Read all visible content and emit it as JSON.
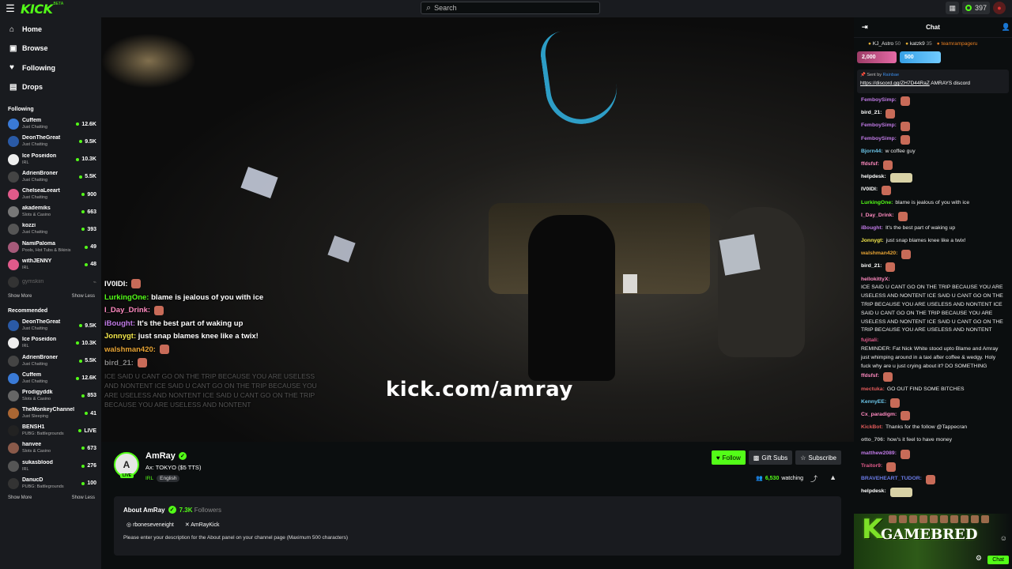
{
  "header": {
    "logo": "KICK",
    "logo_tag": "BETA",
    "search_placeholder": "Search",
    "coins": "397"
  },
  "sidebar": {
    "nav": [
      {
        "label": "Home",
        "icon": "home-icon",
        "glyph": "⌂"
      },
      {
        "label": "Browse",
        "icon": "browse-icon",
        "glyph": "▣"
      },
      {
        "label": "Following",
        "icon": "heart-icon",
        "glyph": "♥"
      },
      {
        "label": "Drops",
        "icon": "drops-icon",
        "glyph": "▤"
      }
    ],
    "following_title": "Following",
    "following": [
      {
        "name": "Cuffem",
        "category": "Just Chatting",
        "viewers": "12.6K",
        "color": "#3a7ad6"
      },
      {
        "name": "DeonTheGreat",
        "category": "Just Chatting",
        "viewers": "9.5K",
        "color": "#2a5aa6"
      },
      {
        "name": "Ice Poseidon",
        "category": "IRL",
        "viewers": "10.3K",
        "color": "#eeeeee"
      },
      {
        "name": "AdrienBroner",
        "category": "Just Chatting",
        "viewers": "5.5K",
        "color": "#444444"
      },
      {
        "name": "ChelseaLeeart",
        "category": "Just Chatting",
        "viewers": "900",
        "color": "#e05a8a"
      },
      {
        "name": "akademiks",
        "category": "Slots & Casino",
        "viewers": "663",
        "color": "#777777"
      },
      {
        "name": "kozzi",
        "category": "Just Chatting",
        "viewers": "393",
        "color": "#555555"
      },
      {
        "name": "NamiPaloma",
        "category": "Pools, Hot Tubs & Bikinis",
        "viewers": "49",
        "color": "#a65a7a"
      },
      {
        "name": "withJENNY",
        "category": "IRL",
        "viewers": "48",
        "color": "#e05a8a"
      }
    ],
    "offline_channel": "gymskiin",
    "show_more": "Show More",
    "show_less": "Show Less",
    "recommended_title": "Recommended",
    "recommended": [
      {
        "name": "DeonTheGreat",
        "category": "Just Chatting",
        "viewers": "9.5K",
        "color": "#2a5aa6"
      },
      {
        "name": "Ice Poseidon",
        "category": "IRL",
        "viewers": "10.3K",
        "color": "#eeeeee"
      },
      {
        "name": "AdrienBroner",
        "category": "Just Chatting",
        "viewers": "5.5K",
        "color": "#444444"
      },
      {
        "name": "Cuffem",
        "category": "Just Chatting",
        "viewers": "12.6K",
        "color": "#3a7ad6"
      },
      {
        "name": "Prodigyddk",
        "category": "Slots & Casino",
        "viewers": "853",
        "color": "#666666"
      },
      {
        "name": "TheMonkeyChannel",
        "category": "Just Sleeping",
        "viewers": "41",
        "color": "#aa6633"
      },
      {
        "name": "BENSH1",
        "category": "PUBG: Battlegrounds",
        "viewers": "LIVE",
        "color": "#222222"
      },
      {
        "name": "hanvee",
        "category": "Slots & Casino",
        "viewers": "673",
        "color": "#8a5a4a"
      },
      {
        "name": "sukasblood",
        "category": "IRL",
        "viewers": "276",
        "color": "#555555"
      },
      {
        "name": "DanucD",
        "category": "PUBG: Battlegrounds",
        "viewers": "100",
        "color": "#333333"
      }
    ]
  },
  "video": {
    "overlay_chat": [
      {
        "user": "IV0IDI:",
        "text": "",
        "color": "#ffffff"
      },
      {
        "user": "LurkingOne:",
        "text": "blame is jealous of you with ice",
        "color": "#53fc18"
      },
      {
        "user": "I_Day_Drink:",
        "text": "",
        "color": "#ff8ac0"
      },
      {
        "user": "iBought:",
        "text": "It's the best part of waking up",
        "color": "#c07ae6"
      },
      {
        "user": "Jonnygt:",
        "text": "just snap blames knee like a twix!",
        "color": "#f2e64b"
      },
      {
        "user": "walshman420:",
        "text": "",
        "color": "#e6a334"
      },
      {
        "user": "bird_21:",
        "text": "",
        "color": "#888888"
      }
    ],
    "overlay_faded": "ICE SAID U CANT GO ON THE TRIP BECAUSE YOU ARE USELESS AND NONTENT ICE SAID U CANT GO ON THE TRIP BECAUSE YOU ARE USELESS AND NONTENT ICE SAID U CANT GO ON THE TRIP BECAUSE YOU ARE USELESS AND NONTENT",
    "watermark": "kick.com/amray"
  },
  "stream": {
    "streamer": "AmRay",
    "live": "LIVE",
    "title": "Ax: TOKYO ($5 TTS)",
    "category": "IRL",
    "language": "English",
    "follow": "Follow",
    "gift_subs": "Gift Subs",
    "subscribe": "Subscribe",
    "viewers": "6,530",
    "watching": "watching"
  },
  "about": {
    "title": "About AmRay",
    "followers_count": "7.3K",
    "followers_label": "Followers",
    "instagram": "rboneseveneight",
    "x": "AmRayKick",
    "description": "Please enter your description for the About panel on your channel page (Maximum 500 characters)"
  },
  "chat": {
    "title": "Chat",
    "top_gifters": [
      {
        "name": "KJ_Astro",
        "count": "50"
      },
      {
        "name": "katzk9",
        "count": "35"
      },
      {
        "name": "teamrampageru",
        "count": ""
      }
    ],
    "pill_pink": "2,000",
    "pill_blue": "500",
    "pinned_by_label": "Sent by",
    "pinned_by_user": "Rainbae",
    "pinned_link": "https://discord.gg/ZH7D44RaZ",
    "pinned_text": "AMRAYS discord",
    "messages": [
      {
        "user": "FemboySimp:",
        "text": "",
        "color": "#c07ae6",
        "emote": "normal"
      },
      {
        "user": "bird_21:",
        "text": "",
        "color": "#ffffff",
        "emote": "normal"
      },
      {
        "user": "FemboySimp:",
        "text": "",
        "color": "#c07ae6",
        "emote": "normal"
      },
      {
        "user": "FemboySimp:",
        "text": "",
        "color": "#c07ae6",
        "emote": "normal"
      },
      {
        "user": "Bjorn44:",
        "text": "w coffee guy",
        "color": "#6ac3e6",
        "emote": ""
      },
      {
        "user": "ffdsfsf:",
        "text": "",
        "color": "#ff8ac0",
        "emote": "normal"
      },
      {
        "user": "helpdesk:",
        "text": "",
        "color": "#ffffff",
        "emote": "big"
      },
      {
        "user": "IV0IDI:",
        "text": "",
        "color": "#ffffff",
        "emote": "normal"
      },
      {
        "user": "LurkingOne:",
        "text": "blame is jealous of you with ice",
        "color": "#53fc18",
        "emote": ""
      },
      {
        "user": "I_Day_Drink:",
        "text": "",
        "color": "#ff8ac0",
        "emote": "normal"
      },
      {
        "user": "iBought:",
        "text": "It's the best part of waking up",
        "color": "#c07ae6",
        "emote": ""
      },
      {
        "user": "Jonnygt:",
        "text": "just snap blames knee like a twix!",
        "color": "#f2e64b",
        "emote": ""
      },
      {
        "user": "walshman420:",
        "text": "",
        "color": "#e6a334",
        "emote": "normal"
      },
      {
        "user": "bird_21:",
        "text": "",
        "color": "#ffffff",
        "emote": "normal"
      },
      {
        "user": "hellokittyX:",
        "text": "ICE SAID U CANT GO ON THE TRIP BECAUSE YOU ARE USELESS AND NONTENT ICE SAID U CANT GO ON THE TRIP BECAUSE YOU ARE USELESS AND NONTENT ICE SAID U CANT GO ON THE TRIP BECAUSE YOU ARE USELESS AND NONTENT ICE SAID U CANT GO ON THE TRIP BECAUSE YOU ARE USELESS AND NONTENT",
        "color": "#ff8ac0",
        "emote": ""
      },
      {
        "user": "fujitali:",
        "text": "REMINDER: Fat Nick White stood upto Blame and Amray just whimping around in a taxi after coffee & wedgy. Holy fuck why are u just crying about it? DO SOMETHING",
        "color": "#e05a8a",
        "emote": ""
      },
      {
        "user": "ffdsfsf:",
        "text": "",
        "color": "#ff8ac0",
        "emote": "normal"
      },
      {
        "user": "mectuka:",
        "text": "GO OUT FIND SOME BITCHES",
        "color": "#e05a5a",
        "emote": ""
      },
      {
        "user": "KennyEE:",
        "text": "",
        "color": "#6ac3e6",
        "emote": "normal"
      },
      {
        "user": "Cx_paradigm:",
        "text": "",
        "color": "#ff8ac0",
        "emote": "normal"
      },
      {
        "user": "KickBot:",
        "text": "Thanks for the follow @Tappecran",
        "color": "#e05a5a",
        "emote": ""
      },
      {
        "user": "otto_706:",
        "text": "how's it feel to have money",
        "color": "#bbbbbb",
        "emote": ""
      },
      {
        "user": "matthew2089:",
        "text": "",
        "color": "#c07ae6",
        "emote": "normal"
      },
      {
        "user": "Traitor9:",
        "text": "",
        "color": "#e05a8a",
        "emote": "normal"
      },
      {
        "user": "BRAVEHEART_TUDOR:",
        "text": "",
        "color": "#6a7ae6",
        "emote": "normal"
      },
      {
        "user": "helpdesk:",
        "text": "",
        "color": "#ffffff",
        "emote": "big"
      }
    ],
    "overlay_brand": "GAMEBRED",
    "chat_button": "Chat"
  }
}
